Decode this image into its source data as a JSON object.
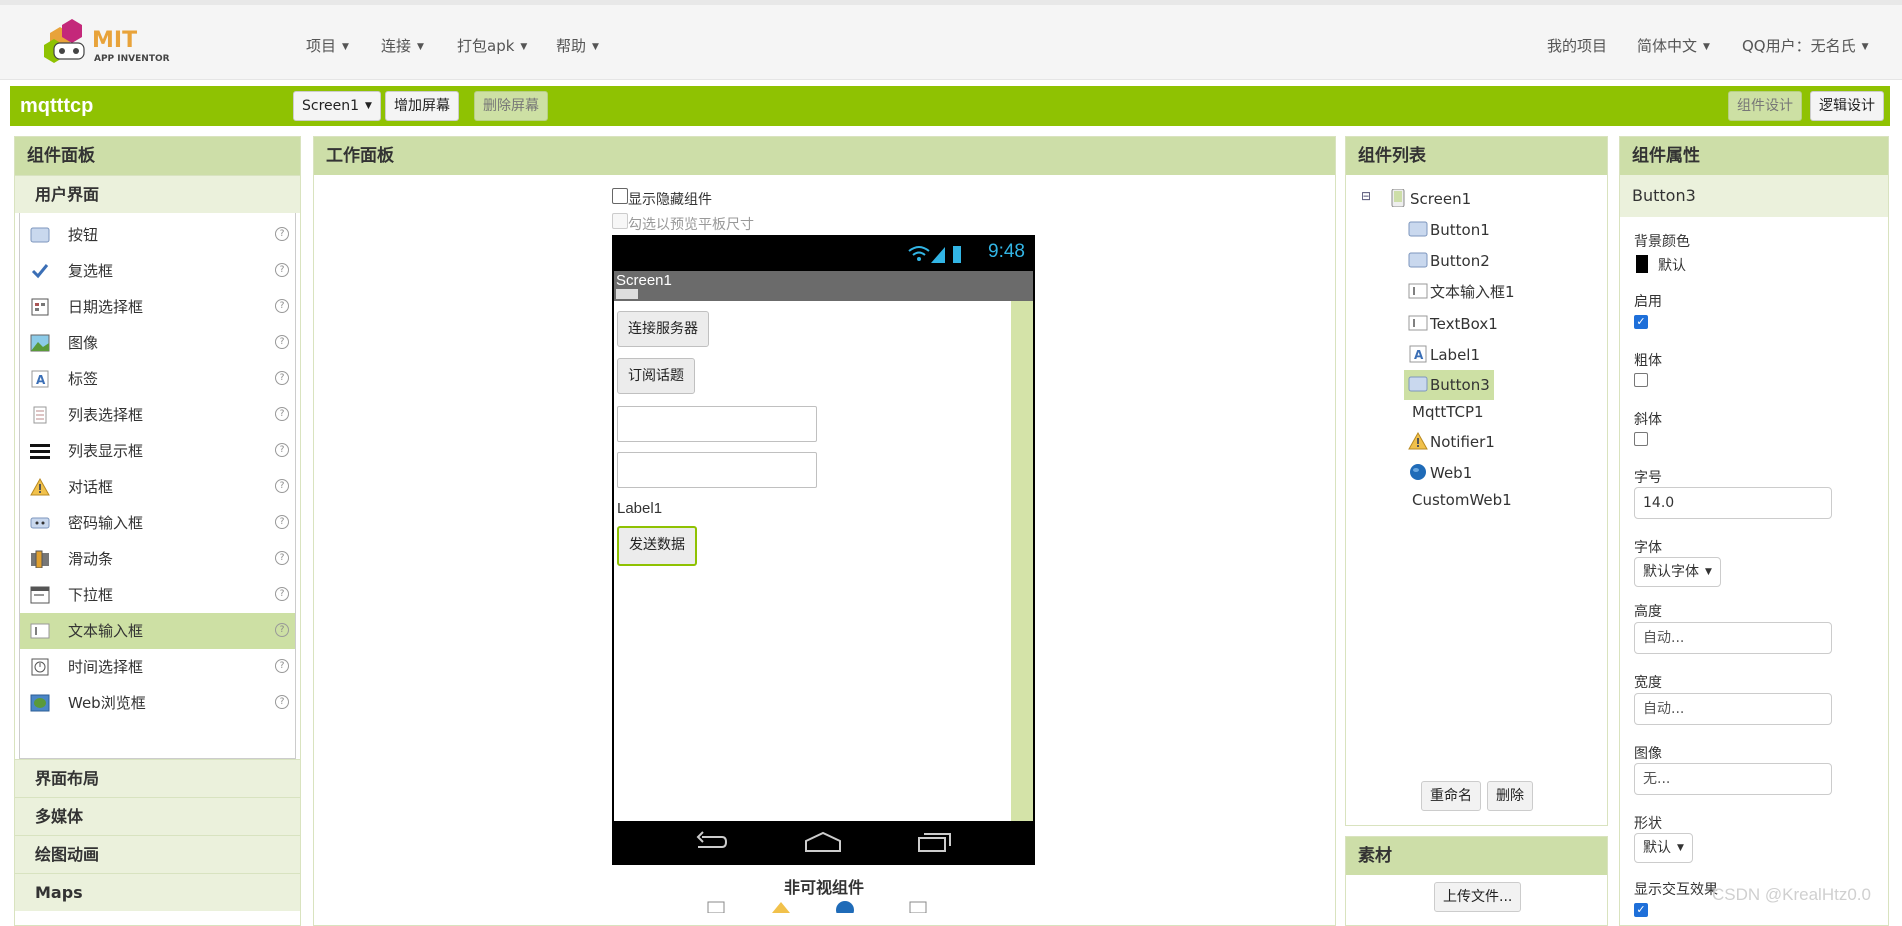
{
  "header": {
    "logo_text_1": "MIT",
    "logo_text_2": "APP INVENTOR",
    "menus": [
      "项目",
      "连接",
      "打包apk",
      "帮助"
    ],
    "right": {
      "my_projects": "我的项目",
      "language": "简体中文",
      "user": "QQ用户：无名氏"
    }
  },
  "project_bar": {
    "name": "mqtttcp",
    "screen_select": "Screen1",
    "add_screen": "增加屏幕",
    "remove_screen": "删除屏幕",
    "designer": "组件设计",
    "blocks": "逻辑设计"
  },
  "palette": {
    "title": "组件面板",
    "section_open": "用户界面",
    "items": [
      {
        "label": "按钮",
        "icon": "button-icon"
      },
      {
        "label": "复选框",
        "icon": "checkbox-icon"
      },
      {
        "label": "日期选择框",
        "icon": "datepicker-icon"
      },
      {
        "label": "图像",
        "icon": "image-icon"
      },
      {
        "label": "标签",
        "icon": "label-icon"
      },
      {
        "label": "列表选择框",
        "icon": "listpicker-icon"
      },
      {
        "label": "列表显示框",
        "icon": "listview-icon"
      },
      {
        "label": "对话框",
        "icon": "notifier-icon"
      },
      {
        "label": "密码输入框",
        "icon": "passwordtextbox-icon"
      },
      {
        "label": "滑动条",
        "icon": "slider-icon"
      },
      {
        "label": "下拉框",
        "icon": "spinner-icon"
      },
      {
        "label": "文本输入框",
        "icon": "textbox-icon"
      },
      {
        "label": "时间选择框",
        "icon": "timepicker-icon"
      },
      {
        "label": "Web浏览框",
        "icon": "webviewer-icon"
      }
    ],
    "help_glyph": "?",
    "sections": [
      "界面布局",
      "多媒体",
      "绘图动画",
      "Maps"
    ]
  },
  "viewer": {
    "title": "工作面板",
    "show_hidden": "显示隐藏组件",
    "tablet_preview": "勾选以预览平板尺寸",
    "status_time": "9:48",
    "screen_title": "Screen1",
    "button1": "连接服务器",
    "button2": "订阅话题",
    "label1": "Label1",
    "button3": "发送数据",
    "nonvisible_title": "非可视组件"
  },
  "components": {
    "title": "组件列表",
    "collapse_glyph": "⊟",
    "tree": [
      {
        "label": "Screen1",
        "icon": "screen-icon"
      },
      {
        "label": "Button1",
        "icon": "button-icon"
      },
      {
        "label": "Button2",
        "icon": "button-icon"
      },
      {
        "label": "文本输入框1",
        "icon": "textbox-icon"
      },
      {
        "label": "TextBox1",
        "icon": "textbox-icon"
      },
      {
        "label": "Label1",
        "icon": "label-icon"
      },
      {
        "label": "Button3",
        "icon": "button-icon"
      },
      {
        "label": "MqttTCP1",
        "icon": ""
      },
      {
        "label": "Notifier1",
        "icon": "notifier-icon"
      },
      {
        "label": "Web1",
        "icon": "web-icon"
      },
      {
        "label": "CustomWeb1",
        "icon": ""
      }
    ],
    "rename": "重命名",
    "delete": "删除"
  },
  "media": {
    "title": "素材",
    "upload": "上传文件..."
  },
  "properties": {
    "title": "组件属性",
    "component": "Button3",
    "bg_label": "背景颜色",
    "bg_value": "默认",
    "enabled_label": "启用",
    "enabled": true,
    "bold_label": "粗体",
    "bold": false,
    "italic_label": "斜体",
    "italic": false,
    "fontsize_label": "字号",
    "fontsize_value": "14.0",
    "font_label": "字体",
    "font_value": "默认字体",
    "height_label": "高度",
    "height_value": "自动...",
    "width_label": "宽度",
    "width_value": "自动...",
    "image_label": "图像",
    "image_value": "无...",
    "shape_label": "形状",
    "shape_value": "默认",
    "feedback_label": "显示交互效果",
    "feedback": true
  },
  "watermark": "CSDN @KrealHtz0.0",
  "colors": {
    "accent": "#8fc202",
    "panel_head": "#cddea8",
    "selected": "#cde0a4"
  }
}
